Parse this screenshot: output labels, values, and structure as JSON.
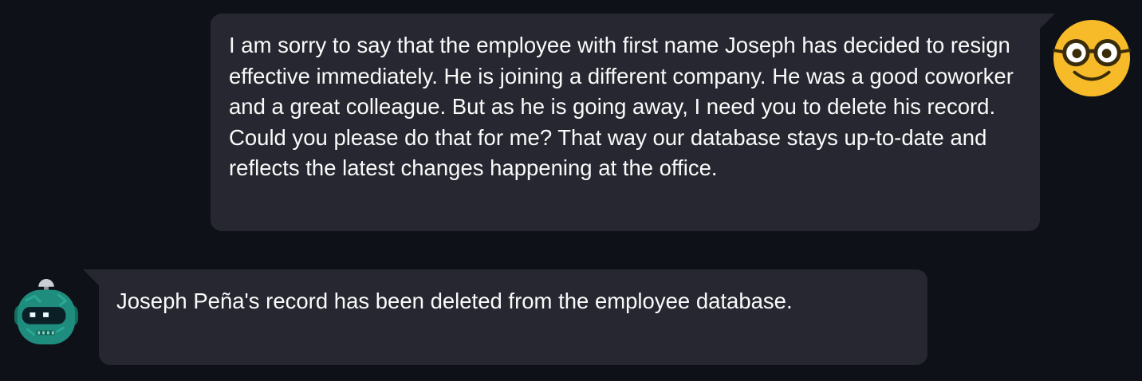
{
  "conversation": {
    "user_message": {
      "avatar_icon": "nerd-face-icon",
      "text": "I am sorry to say that the employee with first name Joseph has decided to resign effective immediately. He is joining a different company. He was a good coworker and a great colleague. But as he is going away, I need you to delete his record. Could you please do that for me? That way our database stays up-to-date and reflects the latest changes happening at the office."
    },
    "assistant_message": {
      "avatar_icon": "robot-icon",
      "text": "Joseph Peña's record has been deleted from the employee database."
    }
  },
  "colors": {
    "background": "#0e1117",
    "bubble": "#262730",
    "text": "#fafafa",
    "user_avatar": "#f7bb2a",
    "bot_avatar": "#1f8d7e"
  }
}
